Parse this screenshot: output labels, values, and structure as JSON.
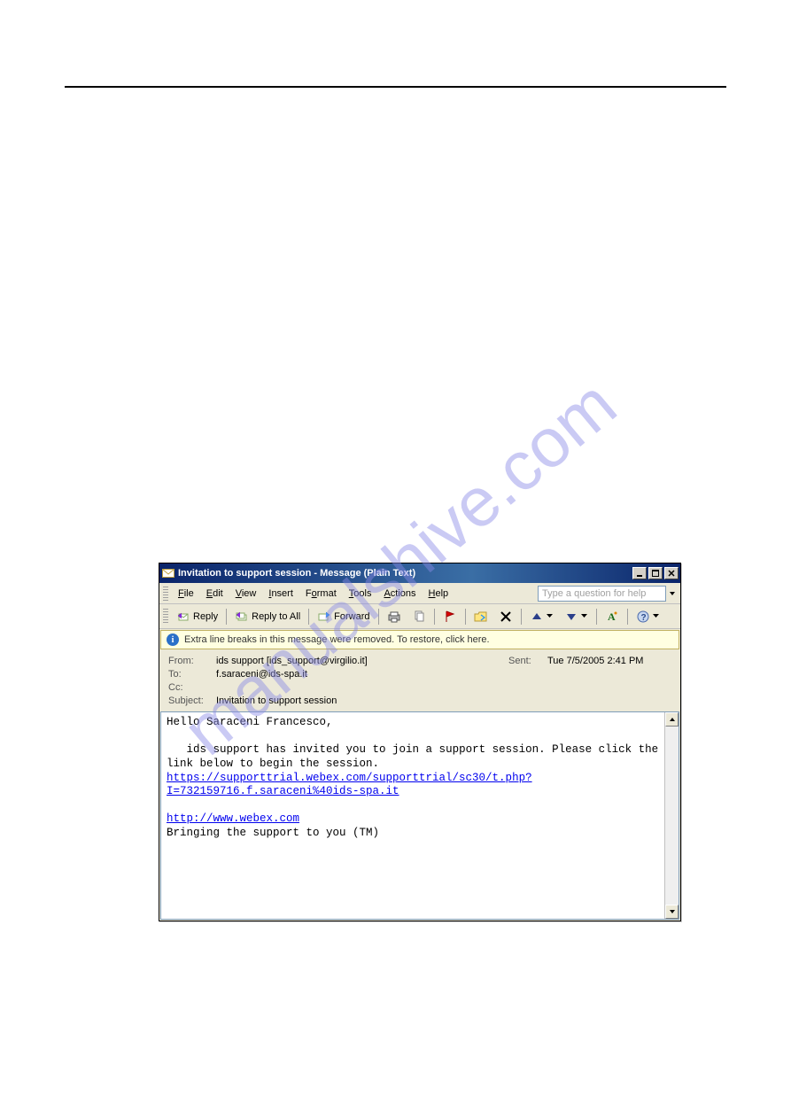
{
  "window": {
    "title": "Invitation to support session - Message (Plain Text)"
  },
  "menu": {
    "file": "File",
    "edit": "Edit",
    "view": "View",
    "insert": "Insert",
    "format": "Format",
    "tools": "Tools",
    "actions": "Actions",
    "help": "Help",
    "help_placeholder": "Type a question for help"
  },
  "toolbar": {
    "reply": "Reply",
    "reply_all": "Reply to All",
    "forward": "Forward"
  },
  "infobar": {
    "text": "Extra line breaks in this message were removed. To restore, click here."
  },
  "header": {
    "from_label": "From:",
    "from_value": "ids support [ids_support@virgilio.it]",
    "sent_label": "Sent:",
    "sent_value": "Tue 7/5/2005 2:41 PM",
    "to_label": "To:",
    "to_value": "f.saraceni@ids-spa.it",
    "cc_label": "Cc:",
    "cc_value": "",
    "subject_label": "Subject:",
    "subject_value": "Invitation to support session"
  },
  "body": {
    "greeting": "Hello Saraceni Francesco,",
    "para1": "   ids support has invited you to join a support session. Please click the link below to begin the session.",
    "link1": "https://supporttrial.webex.com/supporttrial/sc30/t.php?I=732159716.f.saraceni%40ids-spa.it",
    "link2": "http://www.webex.com",
    "tagline": "Bringing the support to you (TM)"
  }
}
